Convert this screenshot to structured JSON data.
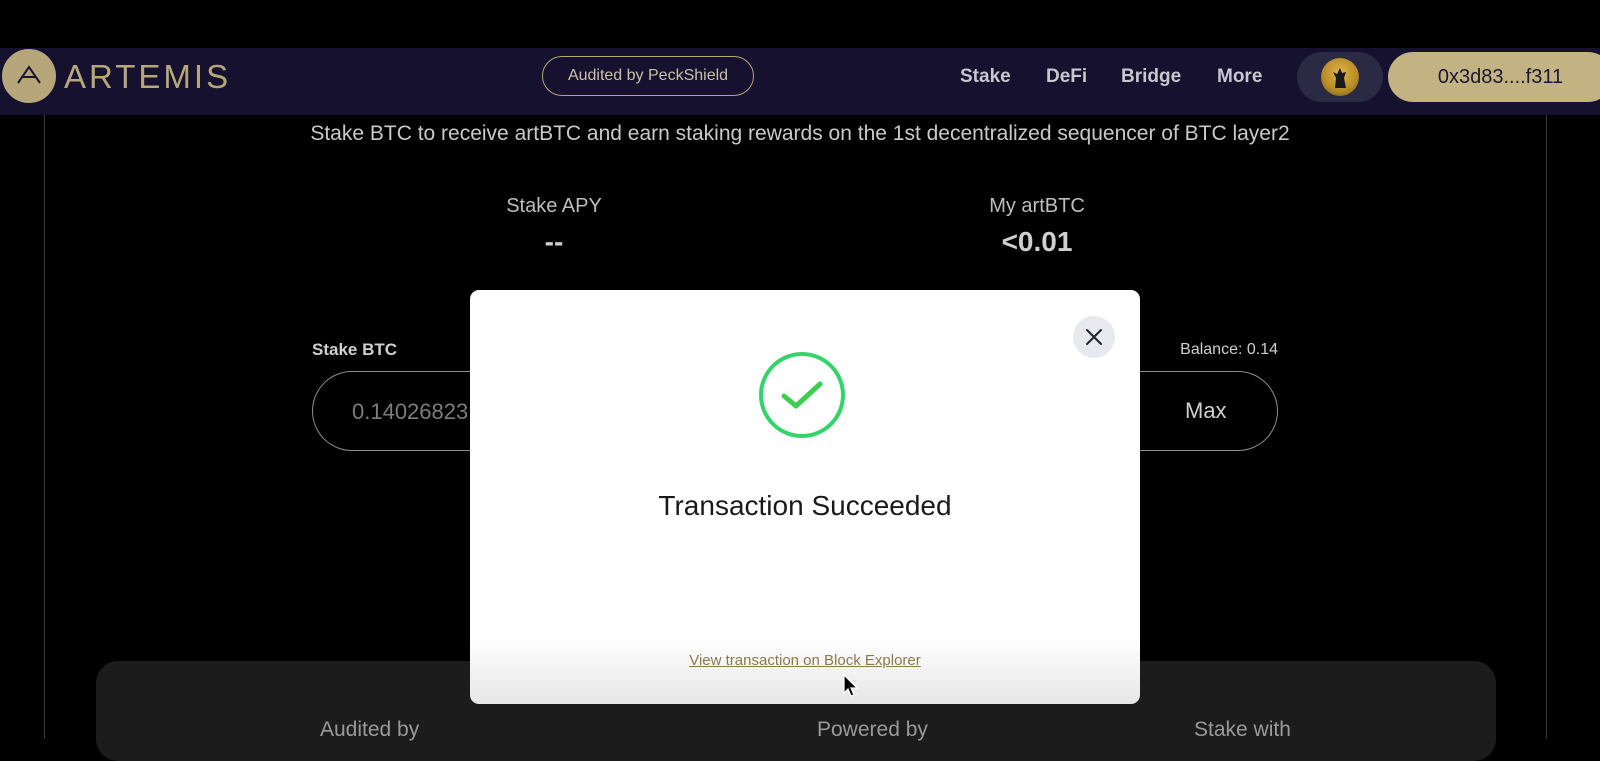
{
  "header": {
    "logo_text": "ARTEMIS",
    "audit_badge": "Audited by PeckShield",
    "nav": [
      "Stake",
      "DeFi",
      "Bridge",
      "More"
    ],
    "wallet_address": "0x3d83....f311"
  },
  "page": {
    "subtitle": "Stake BTC to receive artBTC and earn staking rewards on the 1st decentralized sequencer of BTC layer2",
    "stake_apy_label": "Stake APY",
    "stake_apy_value": "--",
    "my_artbtc_label": "My artBTC",
    "my_artbtc_value": "<0.01",
    "stake_label": "Stake BTC",
    "balance": "Balance: 0.14",
    "stake_input_value": "0.14026823",
    "max_label": "Max",
    "bottom_labels": [
      "Audited by",
      "Powered by",
      "Stake with"
    ]
  },
  "modal": {
    "title": "Transaction Succeeded",
    "explorer_link": "View transaction on Block Explorer"
  },
  "colors": {
    "header_bg": "#15112e",
    "accent_gold": "#b6a67a",
    "wallet_bg": "#c3b383",
    "success_green": "#34d46b"
  },
  "icons": [
    "artemis-logo-icon",
    "wolf-avatar-icon",
    "close-icon",
    "checkmark-icon",
    "mouse-cursor-icon"
  ]
}
